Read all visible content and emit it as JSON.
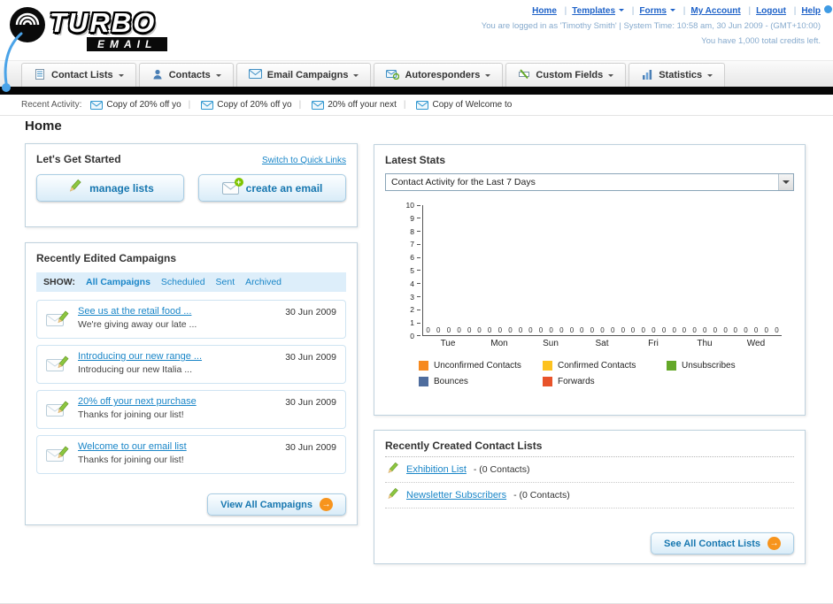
{
  "header": {
    "logo_primary": "TURBO",
    "logo_secondary": "EMAIL",
    "links": [
      {
        "label": "Home"
      },
      {
        "label": "Templates",
        "dropdown": true
      },
      {
        "label": "Forms",
        "dropdown": true
      },
      {
        "label": "My Account"
      },
      {
        "label": "Logout"
      },
      {
        "label": "Help"
      }
    ],
    "session_line": "You are logged in as 'Timothy Smith' | System Time: 10:58 am, 30 Jun 2009 - (GMT+10:00)",
    "credits_line": "You have 1,000 total credits left."
  },
  "main_nav": {
    "tabs": [
      {
        "label": "Contact Lists"
      },
      {
        "label": "Contacts"
      },
      {
        "label": "Email Campaigns"
      },
      {
        "label": "Autoresponders"
      },
      {
        "label": "Custom Fields"
      },
      {
        "label": "Statistics"
      }
    ]
  },
  "recent_activity": {
    "label": "Recent Activity:",
    "items": [
      "Copy of 20% off yo",
      "Copy of 20% off yo",
      "20% off your next",
      "Copy of Welcome to"
    ]
  },
  "page": {
    "title": "Home"
  },
  "get_started": {
    "title": "Let's Get Started",
    "switch_link": "Switch to Quick Links",
    "manage_lists_label": "manage lists",
    "create_email_label": "create an email"
  },
  "campaigns": {
    "title": "Recently Edited Campaigns",
    "show_label": "SHOW:",
    "filters": [
      "All Campaigns",
      "Scheduled",
      "Sent",
      "Archived"
    ],
    "items": [
      {
        "title": "See us at the retail food ...",
        "subtitle": "We're giving away our late ...",
        "date": "30 Jun 2009"
      },
      {
        "title": "Introducing our new range ...",
        "subtitle": "Introducing our new Italia ...",
        "date": "30 Jun 2009"
      },
      {
        "title": "20% off your next purchase",
        "subtitle": "Thanks for joining our list!",
        "date": "30 Jun 2009"
      },
      {
        "title": "Welcome to our email list",
        "subtitle": "Thanks for joining our list!",
        "date": "30 Jun 2009"
      }
    ],
    "view_all_label": "View All Campaigns"
  },
  "latest_stats": {
    "title": "Latest Stats",
    "range_selector": "Contact Activity for the Last 7 Days",
    "chart_data": {
      "type": "bar",
      "title": "Contact Activity for the Last 7 Days",
      "categories": [
        "Tue",
        "Mon",
        "Sun",
        "Sat",
        "Fri",
        "Thu",
        "Wed"
      ],
      "series": [
        {
          "name": "Unconfirmed Contacts",
          "color": "#f6891f",
          "values": [
            0,
            0,
            0,
            0,
            0,
            0,
            0
          ]
        },
        {
          "name": "Confirmed Contacts",
          "color": "#fdc21f",
          "values": [
            0,
            0,
            0,
            0,
            0,
            0,
            0
          ]
        },
        {
          "name": "Unsubscribes",
          "color": "#64a829",
          "values": [
            0,
            0,
            0,
            0,
            0,
            0,
            0
          ]
        },
        {
          "name": "Bounces",
          "color": "#4f6d9e",
          "values": [
            0,
            0,
            0,
            0,
            0,
            0,
            0
          ]
        },
        {
          "name": "Forwards",
          "color": "#e8532a",
          "values": [
            0,
            0,
            0,
            0,
            0,
            0,
            0
          ]
        }
      ],
      "ylim": [
        0,
        10
      ],
      "ytick_step": 1,
      "grid": false,
      "legend_position": "bottom",
      "data_labels": true
    }
  },
  "contact_lists": {
    "title": "Recently Created Contact Lists",
    "items": [
      {
        "name": "Exhibition List",
        "suffix": "- (0 Contacts)"
      },
      {
        "name": "Newsletter Subscribers",
        "suffix": "- (0 Contacts)"
      }
    ],
    "see_all_label": "See All Contact Lists"
  }
}
